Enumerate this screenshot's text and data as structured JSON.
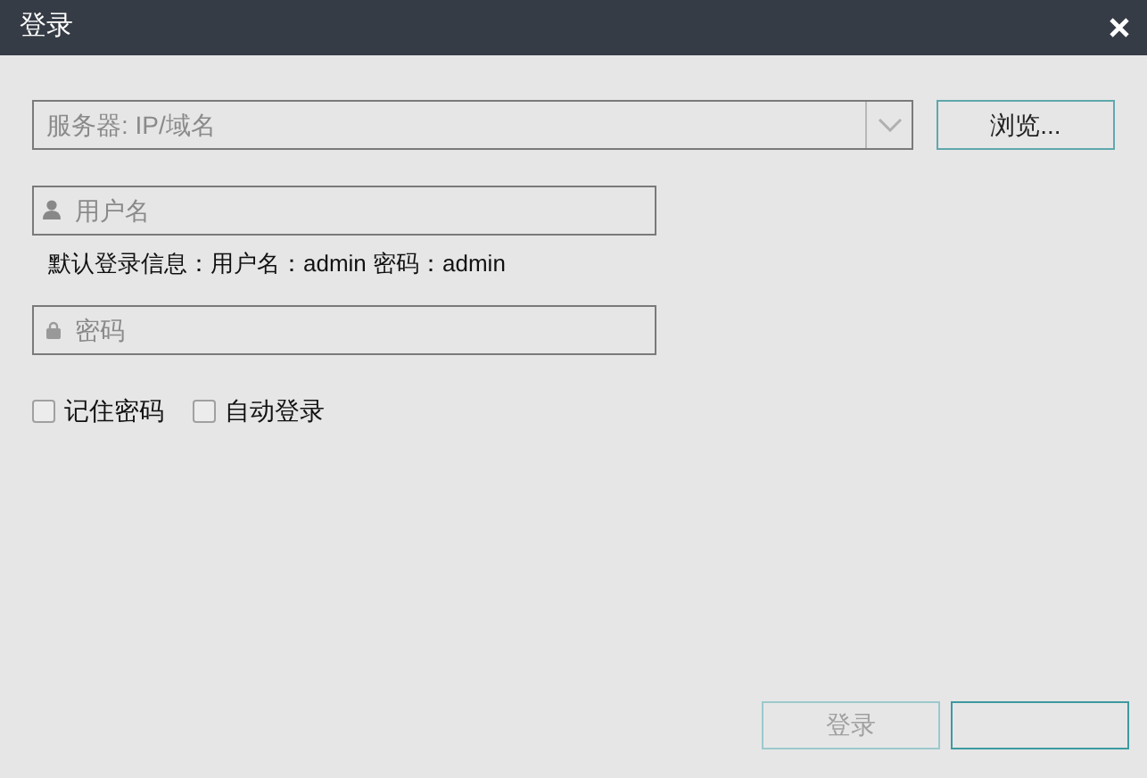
{
  "window": {
    "title": "登录"
  },
  "server": {
    "placeholder": "服务器: IP/域名"
  },
  "browse_button": {
    "label": "浏览..."
  },
  "username": {
    "placeholder": "用户名"
  },
  "hint": "默认登录信息：用户名：admin 密码：admin",
  "password": {
    "placeholder": "密码"
  },
  "checkboxes": [
    {
      "label": "记住密码",
      "checked": false
    },
    {
      "label": "自动登录",
      "checked": false
    }
  ],
  "buttons": [
    {
      "label": "登录",
      "disabled": true
    },
    {
      "disabled": false
    }
  ]
}
